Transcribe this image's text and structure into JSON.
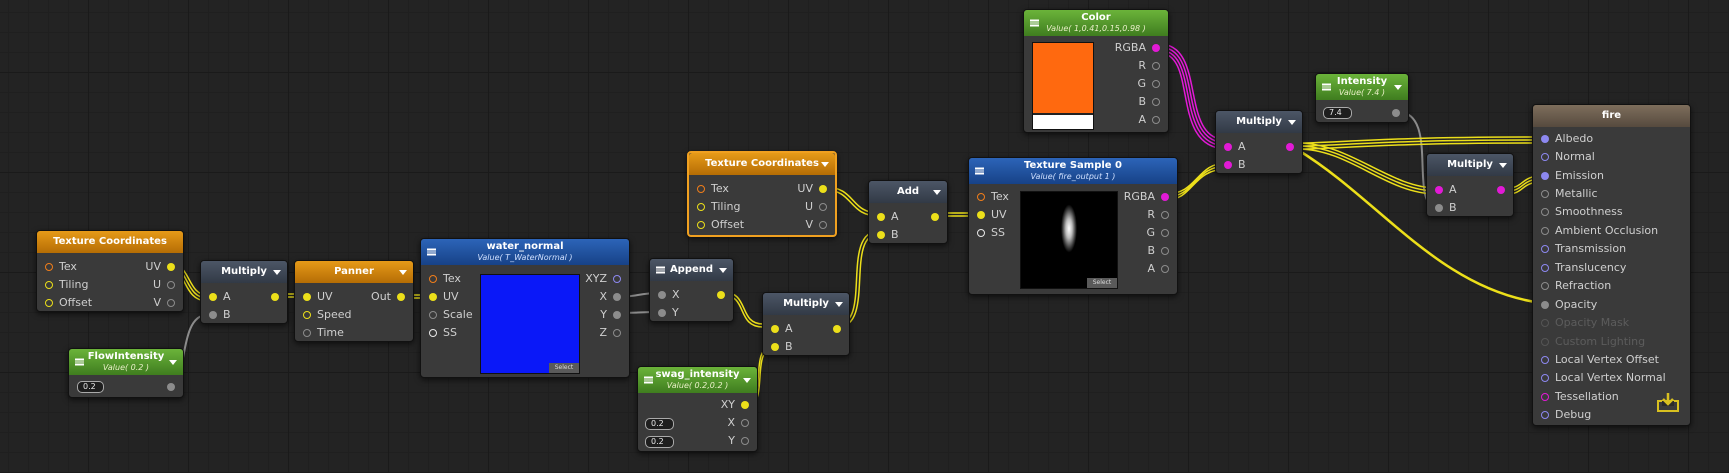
{
  "colors": {
    "wire_yellow": "#ecdf1a",
    "wire_magenta": "#e21ad6",
    "wire_gray": "#8c8c8c",
    "color_value": "#ff690f"
  },
  "nodes": {
    "tc1": {
      "title": "Texture Coordinates",
      "in_tex": "Tex",
      "in_tiling": "Tiling",
      "in_offset": "Offset",
      "out_uv": "UV",
      "out_u": "U",
      "out_v": "V"
    },
    "flow": {
      "title": "FlowIntensity",
      "subtitle": "Value( 0.2 )",
      "value": "0.2"
    },
    "mul1": {
      "title": "Multiply",
      "in_a": "A",
      "in_b": "B"
    },
    "panner": {
      "title": "Panner",
      "in_uv": "UV",
      "in_speed": "Speed",
      "in_time": "Time",
      "out": "Out"
    },
    "water": {
      "title": "water_normal",
      "subtitle": "Value( T_WaterNormal )",
      "in_tex": "Tex",
      "in_uv": "UV",
      "in_scale": "Scale",
      "in_ss": "SS",
      "out_xyz": "XYZ",
      "out_x": "X",
      "out_y": "Y",
      "out_z": "Z",
      "select_label": "Select"
    },
    "append": {
      "title": "Append",
      "in_x": "X",
      "in_y": "Y"
    },
    "tc2": {
      "title": "Texture Coordinates",
      "in_tex": "Tex",
      "in_tiling": "Tiling",
      "in_offset": "Offset",
      "out_uv": "UV",
      "out_u": "U",
      "out_v": "V"
    },
    "swag": {
      "title": "swag_intensity",
      "subtitle": "Value( 0.2,0.2 )",
      "out_xy": "XY",
      "out_x": "X",
      "out_y": "Y",
      "value_x": "0.2",
      "value_y": "0.2"
    },
    "mul2": {
      "title": "Multiply",
      "in_a": "A",
      "in_b": "B"
    },
    "add": {
      "title": "Add",
      "in_a": "A",
      "in_b": "B"
    },
    "texsample": {
      "title": "Texture Sample 0",
      "subtitle": "Value( fire_output 1 )",
      "in_tex": "Tex",
      "in_uv": "UV",
      "in_ss": "SS",
      "out_rgba": "RGBA",
      "out_r": "R",
      "out_g": "G",
      "out_b": "B",
      "out_a": "A",
      "select_label": "Select"
    },
    "color": {
      "title": "Color",
      "subtitle": "Value( 1,0.41,0.15,0.98 )",
      "out_rgba": "RGBA",
      "out_r": "R",
      "out_g": "G",
      "out_b": "B",
      "out_a": "A"
    },
    "mul3": {
      "title": "Multiply",
      "in_a": "A",
      "in_b": "B"
    },
    "intensity": {
      "title": "Intensity",
      "subtitle": "Value( 7.4 )",
      "value": "7.4"
    },
    "mul4": {
      "title": "Multiply",
      "in_a": "A",
      "in_b": "B"
    },
    "fire": {
      "title": "fire",
      "inputs": [
        "Albedo",
        "Normal",
        "Emission",
        "Metallic",
        "Smoothness",
        "Ambient Occlusion",
        "Transmission",
        "Translucency",
        "Refraction",
        "Opacity",
        "Opacity Mask",
        "Custom Lighting",
        "Local Vertex Offset",
        "Local Vertex Normal",
        "Tessellation",
        "Debug"
      ]
    }
  }
}
